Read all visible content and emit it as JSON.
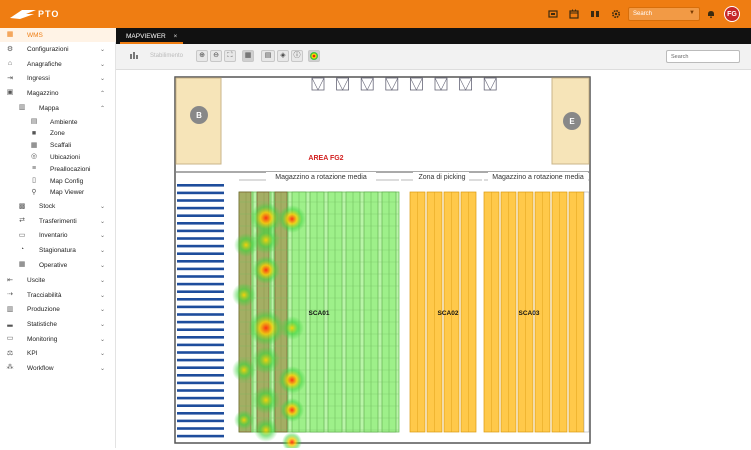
{
  "app": {
    "logo_text": "PTO",
    "user_initials": "FG",
    "search_placeholder": "Search",
    "brand_color": "#ef7d12"
  },
  "sidebar": {
    "items": [
      {
        "label": "WMS",
        "icon": "grid-icon",
        "active": true
      },
      {
        "label": "Configurazioni",
        "icon": "gear-icon",
        "chevron": "down"
      },
      {
        "label": "Anagrafiche",
        "icon": "tag-icon",
        "chevron": "down"
      },
      {
        "label": "Ingressi",
        "icon": "login-icon",
        "chevron": "down"
      },
      {
        "label": "Magazzino",
        "icon": "warehouse-icon",
        "chevron": "up"
      }
    ],
    "magazzino_sub": {
      "label": "Mappa",
      "icon": "map-icon",
      "chevron": "up"
    },
    "mappa_leaves": [
      {
        "label": "Ambiente",
        "icon": "building-icon"
      },
      {
        "label": "Zone",
        "icon": "square-icon"
      },
      {
        "label": "Scaffali",
        "icon": "shelf-icon"
      },
      {
        "label": "Ubicazioni",
        "icon": "target-icon"
      },
      {
        "label": "Preallocazioni",
        "icon": "list-icon"
      },
      {
        "label": "Map Config",
        "icon": "doc-icon"
      },
      {
        "label": "Map Viewer",
        "icon": "pin-icon"
      }
    ],
    "magazzino_more": [
      {
        "label": "Stock",
        "icon": "stock-icon",
        "chevron": "down"
      },
      {
        "label": "Trasferimenti",
        "icon": "transfer-icon",
        "chevron": "down"
      },
      {
        "label": "Inventario",
        "icon": "clipboard-icon",
        "chevron": "down"
      },
      {
        "label": "Stagionatura",
        "icon": "clock-icon",
        "chevron": "down"
      },
      {
        "label": "Operative",
        "icon": "calendar-icon",
        "chevron": "down"
      }
    ],
    "bottom_items": [
      {
        "label": "Uscite",
        "icon": "logout-icon",
        "chevron": "down"
      },
      {
        "label": "Tracciabilità",
        "icon": "trace-icon",
        "chevron": "down"
      },
      {
        "label": "Produzione",
        "icon": "factory-icon",
        "chevron": "down"
      },
      {
        "label": "Statistiche",
        "icon": "bar-chart-icon",
        "chevron": "down"
      },
      {
        "label": "Monitoring",
        "icon": "monitor-icon",
        "chevron": "down"
      },
      {
        "label": "KPI",
        "icon": "kpi-icon",
        "chevron": "down"
      },
      {
        "label": "Workflow",
        "icon": "workflow-icon",
        "chevron": "down"
      }
    ]
  },
  "tabs": [
    {
      "label": "MAPVIEWER",
      "close": "×"
    }
  ],
  "toolbar": {
    "filter_value": "Stabilimento",
    "search_placeholder": "Search"
  },
  "map": {
    "area_label": "AREA FG2",
    "zone_labels": [
      "Magazzino a rotazione media",
      "Zona di picking",
      "Magazzino a rotazione media"
    ],
    "door_labels": [
      "B",
      "E"
    ],
    "aisle_labels": [
      "SCA01",
      "SCA02",
      "SCA03"
    ],
    "colors": {
      "green": "#9ef08a",
      "yellow": "#ffc94a",
      "outline": "#555",
      "area_red": "#d21f1f",
      "heat_red": "#ff3b1f"
    }
  }
}
